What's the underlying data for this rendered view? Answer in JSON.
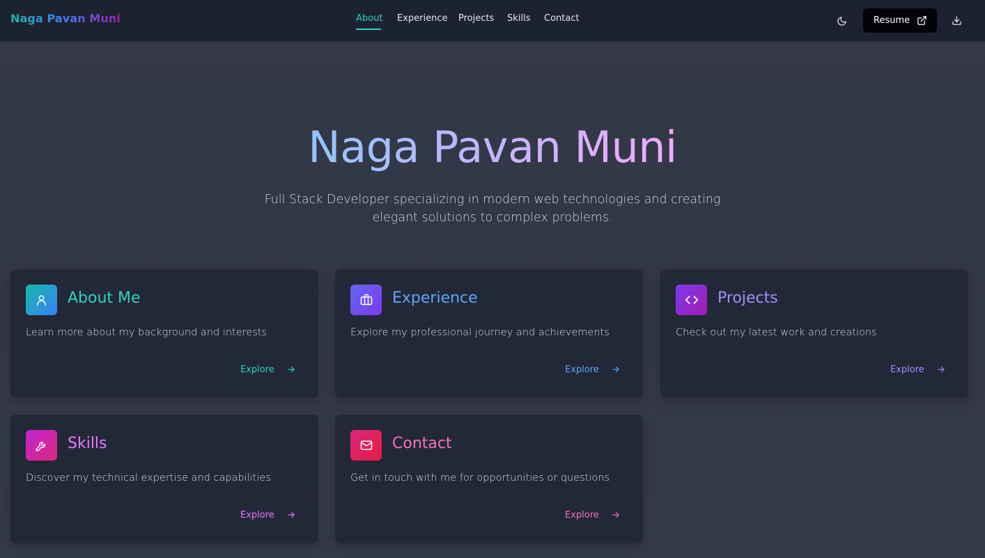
{
  "brand": {
    "name": "Naga Pavan Muni"
  },
  "nav": {
    "items": [
      {
        "label": "About",
        "active": true
      },
      {
        "label": "Experience",
        "active": false
      },
      {
        "label": "Projects",
        "active": false
      },
      {
        "label": "Skills",
        "active": false
      },
      {
        "label": "Contact",
        "active": false
      }
    ],
    "theme_icon": "moon-icon",
    "resume_label": "Resume",
    "resume_icon": "external-link-icon",
    "download_icon": "download-icon"
  },
  "hero": {
    "title": "Naga Pavan Muni",
    "subtitle_line1": "Full Stack Developer specializing in modern web technologies and creating",
    "subtitle_line2": "elegant solutions to complex problems."
  },
  "cards": [
    {
      "title": "About Me",
      "description": "Learn more about my background and interests",
      "cta": "Explore",
      "icon": "user-icon",
      "accent": "#2dd4bf"
    },
    {
      "title": "Experience",
      "description": "Explore my professional journey and achievements",
      "cta": "Explore",
      "icon": "briefcase-icon",
      "accent": "#60a5fa"
    },
    {
      "title": "Projects",
      "description": "Check out my latest work and creations",
      "cta": "Explore",
      "icon": "code-icon",
      "accent": "#a78bfa"
    },
    {
      "title": "Skills",
      "description": "Discover my technical expertise and capabilities",
      "cta": "Explore",
      "icon": "wrench-icon",
      "accent": "#e879f9"
    },
    {
      "title": "Contact",
      "description": "Get in touch with me for opportunities or questions",
      "cta": "Explore",
      "icon": "mail-icon",
      "accent": "#f472b6"
    }
  ],
  "colors": {
    "background": "#343949",
    "navbar": "#1d2230",
    "card": "#222838",
    "active_nav": "#2dd4bf"
  }
}
